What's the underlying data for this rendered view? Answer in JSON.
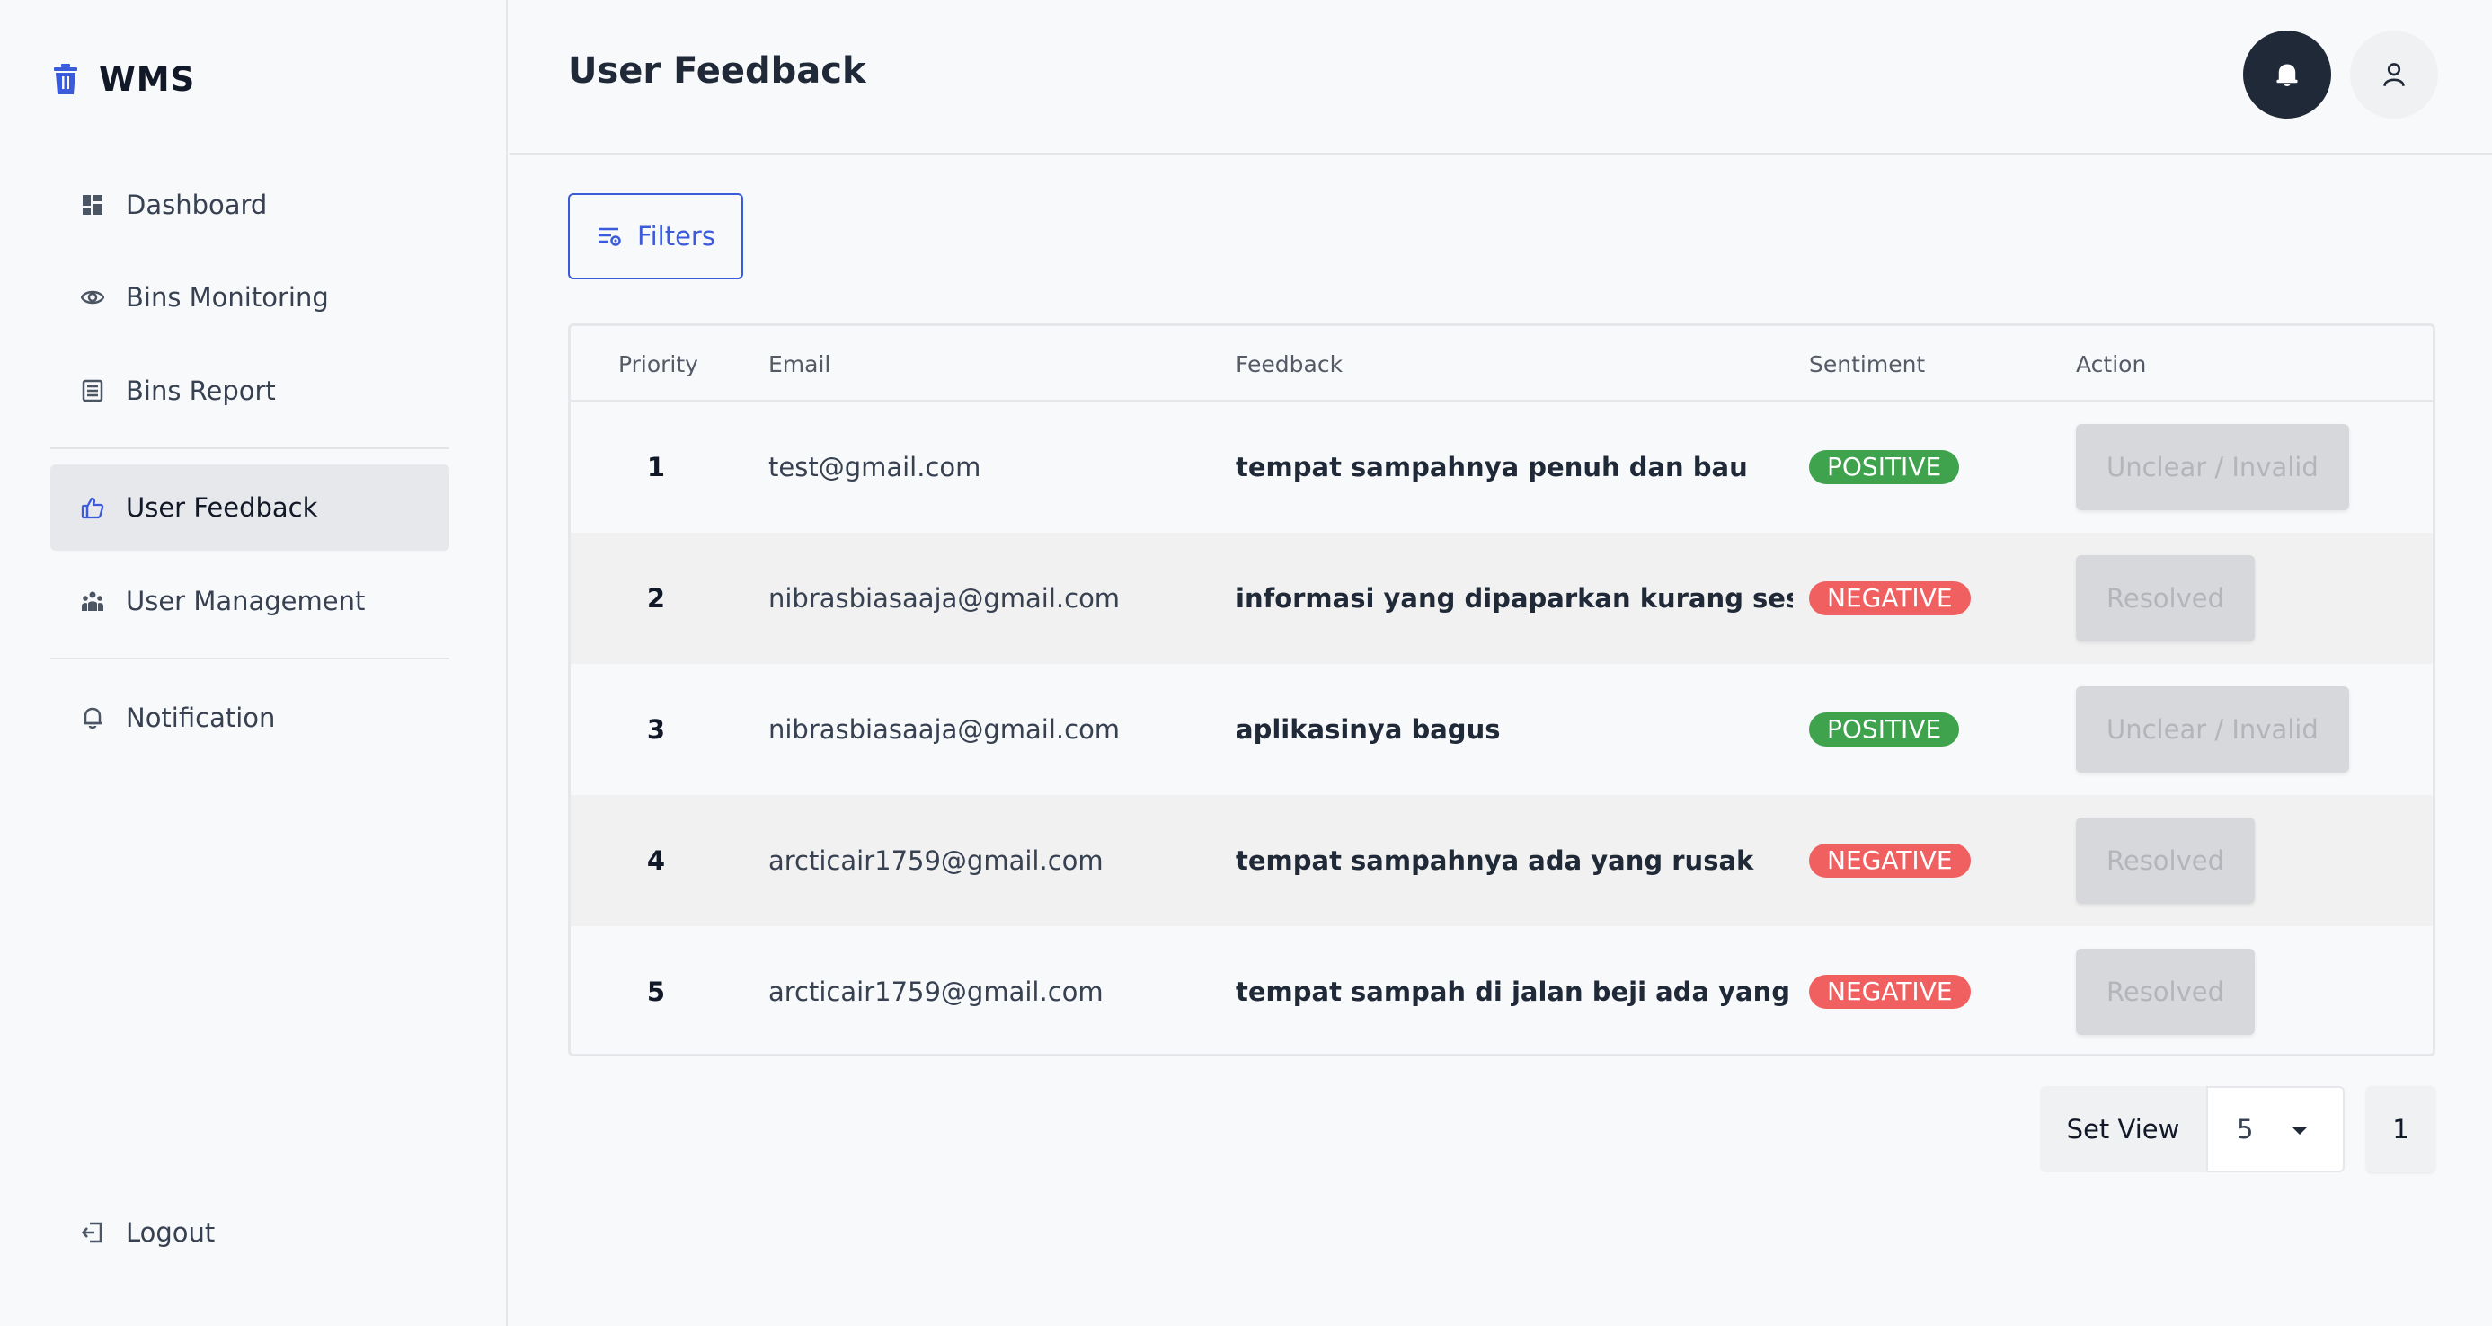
{
  "brand": {
    "name": "WMS",
    "icon": "trash-bin-icon",
    "accent": "#3b5bdb"
  },
  "sidebar": {
    "items": [
      {
        "label": "Dashboard",
        "icon": "dashboard-grid-icon"
      },
      {
        "label": "Bins Monitoring",
        "icon": "eye-icon"
      },
      {
        "label": "Bins Report",
        "icon": "report-list-icon"
      },
      {
        "label": "User Feedback",
        "icon": "thumbs-up-icon",
        "active": true
      },
      {
        "label": "User Management",
        "icon": "users-group-icon"
      },
      {
        "label": "Notification",
        "icon": "bell-icon"
      }
    ],
    "logout": {
      "label": "Logout",
      "icon": "logout-icon"
    }
  },
  "header": {
    "title": "User Feedback",
    "bell_icon": "bell-icon",
    "user_icon": "user-icon"
  },
  "toolbar": {
    "filters_label": "Filters",
    "filters_icon": "filter-sliders-icon"
  },
  "table": {
    "columns": [
      "Priority",
      "Email",
      "Feedback",
      "Sentiment",
      "Action"
    ],
    "rows": [
      {
        "priority": "1",
        "email": "test@gmail.com",
        "feedback": "tempat sampahnya penuh dan bau",
        "sentiment": "POSITIVE",
        "action": "Unclear / Invalid"
      },
      {
        "priority": "2",
        "email": "nibrasbiasaaja@gmail.com",
        "feedback": "informasi yang dipaparkan kurang sesuai ...",
        "sentiment": "NEGATIVE",
        "action": "Resolved"
      },
      {
        "priority": "3",
        "email": "nibrasbiasaaja@gmail.com",
        "feedback": "aplikasinya bagus",
        "sentiment": "POSITIVE",
        "action": "Unclear / Invalid"
      },
      {
        "priority": "4",
        "email": "arcticair1759@gmail.com",
        "feedback": "tempat sampahnya ada yang rusak",
        "sentiment": "NEGATIVE",
        "action": "Resolved"
      },
      {
        "priority": "5",
        "email": "arcticair1759@gmail.com",
        "feedback": "tempat sampah di jalan beji ada yang rusak",
        "sentiment": "NEGATIVE",
        "action": "Resolved"
      }
    ]
  },
  "colors": {
    "positive": "#3fa34d",
    "negative": "#f06060"
  },
  "pagination": {
    "set_view_label": "Set View",
    "view_value": "5",
    "page": "1"
  }
}
